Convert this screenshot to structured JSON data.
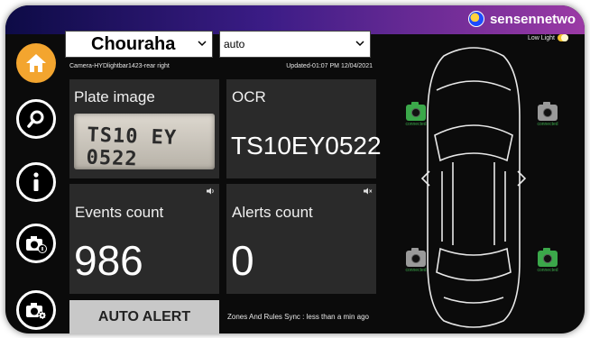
{
  "brand": {
    "name": "sensennetwo"
  },
  "sidebar": {
    "items": [
      {
        "name": "home",
        "icon": "home-icon"
      },
      {
        "name": "search",
        "icon": "search-icon"
      },
      {
        "name": "info",
        "icon": "info-icon"
      },
      {
        "name": "camera-info",
        "icon": "camera-info-icon"
      },
      {
        "name": "camera-settings",
        "icon": "camera-settings-icon"
      }
    ]
  },
  "location_select": {
    "value": "Chouraha"
  },
  "mode_select": {
    "value": "auto"
  },
  "camera_line": {
    "camera": "Camera-HYDlightbar1423-rear right",
    "updated": "Updated-01:07 PM 12/04/2021"
  },
  "plate": {
    "title": "Plate image",
    "plate_text": "TS10 EY 0522"
  },
  "ocr": {
    "title": "OCR",
    "value": "TS10EY0522"
  },
  "events": {
    "title": "Events count",
    "value": "986"
  },
  "alerts": {
    "title": "Alerts count",
    "value": "0"
  },
  "auto_alert": {
    "label": "AUTO ALERT"
  },
  "sync": {
    "text": "Zones And Rules Sync : less than a min ago"
  },
  "low_light": {
    "label": "Low Light",
    "on": true
  },
  "cameras": [
    {
      "position": "front-left",
      "status": "connected",
      "color": "#3ba84a"
    },
    {
      "position": "front-right",
      "status": "connected",
      "color": "#9a9a9a"
    },
    {
      "position": "rear-left",
      "status": "connected",
      "color": "#9a9a9a"
    },
    {
      "position": "rear-right",
      "status": "connected",
      "color": "#3ba84a"
    }
  ],
  "colors": {
    "accent": "#f3a52f",
    "connected": "#3ba84a",
    "panel": "#2a2a2a"
  }
}
